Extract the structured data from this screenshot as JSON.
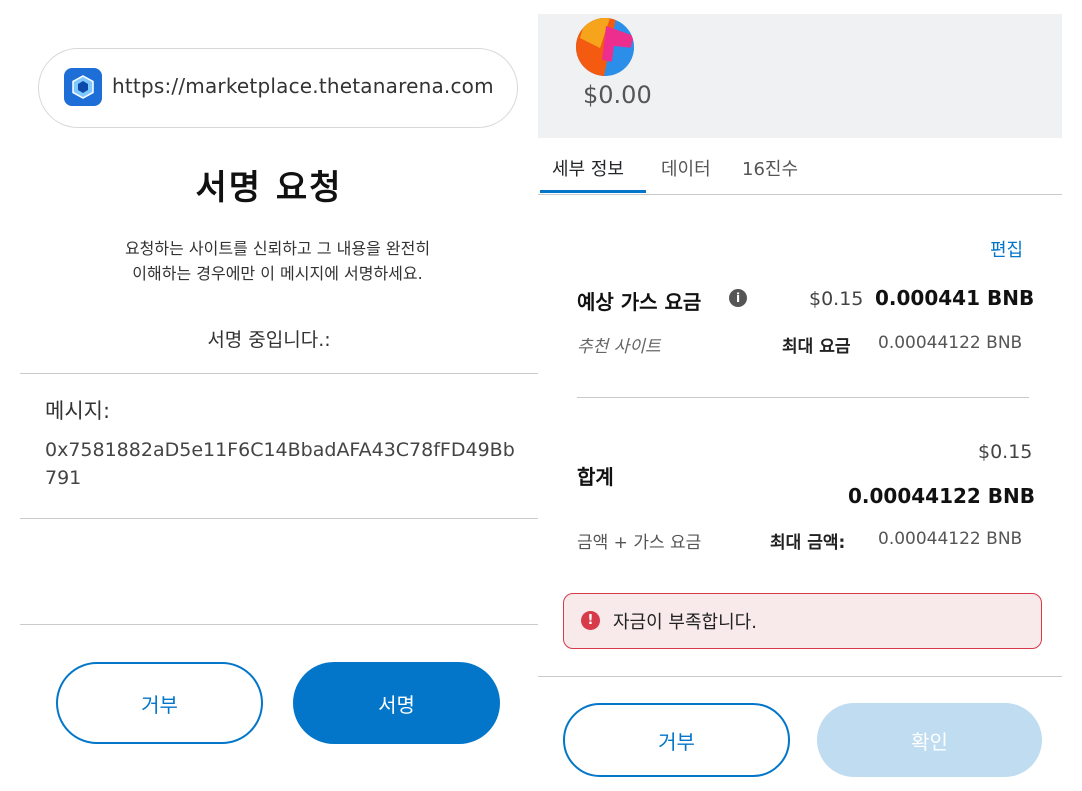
{
  "left": {
    "site_url": "https://marketplace.thetanarena.com",
    "title": "서명 요청",
    "description_line1": "요청하는 사이트를 신뢰하고 그 내용을 완전히",
    "description_line2": "이해하는 경우에만 이 메시지에 서명하세요.",
    "signing_label": "서명 중입니다.:",
    "message_label": "메시지:",
    "message_value": "0x7581882aD5e11F6C14BbadAFA43C78fFD49Bb791",
    "reject_label": "거부",
    "sign_label": "서명"
  },
  "right": {
    "balance": "$0.00",
    "tabs": [
      {
        "label": "세부 정보",
        "active": true
      },
      {
        "label": "데이터",
        "active": false
      },
      {
        "label": "16진수",
        "active": false
      }
    ],
    "edit_label": "편집",
    "gas": {
      "label": "예상 가스 요금",
      "usd": "$0.15",
      "bnb": "0.000441 BNB",
      "suggested": "추천 사이트",
      "max_fee_label": "최대 요금",
      "max_fee_value": "0.00044122 BNB"
    },
    "total": {
      "label": "합계",
      "usd": "$0.15",
      "bnb": "0.00044122 BNB",
      "amount_gas": "금액 + 가스 요금",
      "max_amount_label": "최대 금액:",
      "max_amount_value": "0.00044122 BNB"
    },
    "alert": "자금이 부족합니다.",
    "reject_label": "거부",
    "confirm_label": "확인"
  },
  "colors": {
    "primary": "#0376c9",
    "error": "#d73a49",
    "error_bg": "#f8eaea",
    "header_bg": "#eff1f2",
    "confirm_disabled": "#bfdcf1"
  },
  "icons": {
    "site": "thetan-arena-icon",
    "info": "info-icon",
    "alert": "error-icon",
    "avatar": "account-avatar"
  }
}
